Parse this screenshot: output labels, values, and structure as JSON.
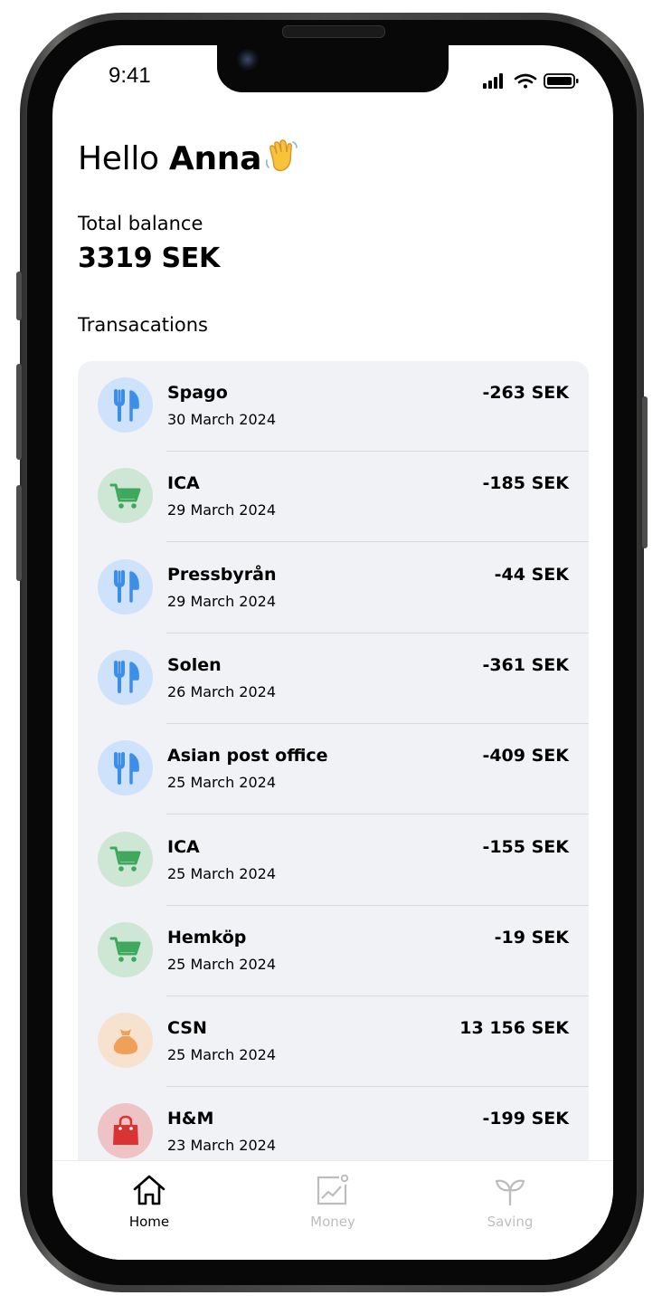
{
  "status_bar": {
    "time": "9:41"
  },
  "greeting": {
    "hello": "Hello",
    "name": "Anna"
  },
  "balance": {
    "label": "Total balance",
    "amount": "3319 SEK"
  },
  "transactions_title": "Transacations",
  "transactions": [
    {
      "name": "Spago",
      "date": "30 March 2024",
      "amount": "-263 SEK",
      "category": "restaurant",
      "icon": "fork-knife-icon",
      "color": "#3d8ee8",
      "bg": "#cfe2fb"
    },
    {
      "name": "ICA",
      "date": "29 March 2024",
      "amount": "-185 SEK",
      "category": "groceries",
      "icon": "cart-icon",
      "color": "#3fa85c",
      "bg": "#cde7d4"
    },
    {
      "name": "Pressbyrån",
      "date": "29 March 2024",
      "amount": "-44 SEK",
      "category": "restaurant",
      "icon": "fork-knife-icon",
      "color": "#3d8ee8",
      "bg": "#cfe2fb"
    },
    {
      "name": "Solen",
      "date": "26 March 2024",
      "amount": "-361 SEK",
      "category": "restaurant",
      "icon": "fork-knife-icon",
      "color": "#3d8ee8",
      "bg": "#cfe2fb"
    },
    {
      "name": "Asian post office",
      "date": "25 March 2024",
      "amount": "-409 SEK",
      "category": "restaurant",
      "icon": "fork-knife-icon",
      "color": "#3d8ee8",
      "bg": "#cfe2fb"
    },
    {
      "name": "ICA",
      "date": "25 March 2024",
      "amount": "-155 SEK",
      "category": "groceries",
      "icon": "cart-icon",
      "color": "#3fa85c",
      "bg": "#cde7d4"
    },
    {
      "name": "Hemköp",
      "date": "25 March 2024",
      "amount": "-19 SEK",
      "category": "groceries",
      "icon": "cart-icon",
      "color": "#3fa85c",
      "bg": "#cde7d4"
    },
    {
      "name": "CSN",
      "date": "25 March 2024",
      "amount": "13 156 SEK",
      "category": "income",
      "icon": "money-bag-icon",
      "color": "#f0a058",
      "bg": "#f6e2cf"
    },
    {
      "name": "H&M",
      "date": "23 March 2024",
      "amount": "-199 SEK",
      "category": "shopping",
      "icon": "shopping-bag-icon",
      "color": "#d93434",
      "bg": "#eec3c6"
    }
  ],
  "tabs": [
    {
      "label": "Home",
      "icon": "home-icon",
      "active": true,
      "color": "#000000"
    },
    {
      "label": "Money",
      "icon": "chart-icon",
      "active": false,
      "color": "#bdbdbd"
    },
    {
      "label": "Saving",
      "icon": "sprout-icon",
      "active": false,
      "color": "#bdbdbd"
    }
  ]
}
